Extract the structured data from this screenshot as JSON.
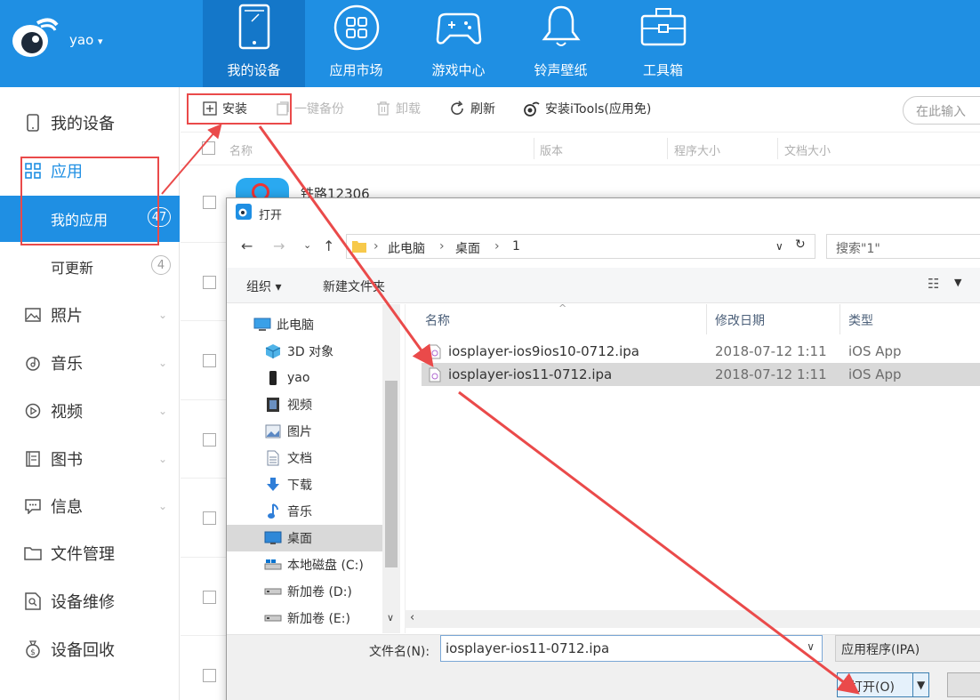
{
  "header": {
    "username": "yao",
    "nav": [
      {
        "label": "我的设备",
        "icon": "phone-icon",
        "active": true
      },
      {
        "label": "应用市场",
        "icon": "apps-grid-icon",
        "active": false
      },
      {
        "label": "游戏中心",
        "icon": "gamepad-icon",
        "active": false
      },
      {
        "label": "铃声壁纸",
        "icon": "bell-icon",
        "active": false
      },
      {
        "label": "工具箱",
        "icon": "toolbox-icon",
        "active": false
      }
    ]
  },
  "sidebar": {
    "my_device": "我的设备",
    "apps": "应用",
    "my_apps": "我的应用",
    "my_apps_count": "47",
    "updatable": "可更新",
    "updatable_count": "4",
    "photos": "照片",
    "music": "音乐",
    "video": "视频",
    "books": "图书",
    "messages": "信息",
    "file_mgmt": "文件管理",
    "repair": "设备维修",
    "recycle": "设备回收"
  },
  "toolbar": {
    "install": "安装",
    "backup": "一键备份",
    "uninstall": "卸载",
    "refresh": "刷新",
    "install_itools": "安装iTools(应用免)",
    "search_placeholder": "在此输入"
  },
  "table": {
    "col_name": "名称",
    "col_version": "版本",
    "col_size": "程序大小",
    "col_doc": "文档大小",
    "row1_name": "铁路12306"
  },
  "dialog": {
    "title": "打开",
    "breadcrumb": [
      "此电脑",
      "桌面",
      "1"
    ],
    "search_placeholder": "搜索\"1\"",
    "organize": "组织 ▾",
    "new_folder": "新建文件夹",
    "tree": [
      {
        "label": "此电脑",
        "icon": "computer-icon"
      },
      {
        "label": "3D 对象",
        "icon": "3d-objects-icon"
      },
      {
        "label": "yao",
        "icon": "iphone-icon"
      },
      {
        "label": "视频",
        "icon": "video-folder-icon"
      },
      {
        "label": "图片",
        "icon": "pictures-folder-icon"
      },
      {
        "label": "文档",
        "icon": "documents-folder-icon"
      },
      {
        "label": "下载",
        "icon": "download-folder-icon"
      },
      {
        "label": "音乐",
        "icon": "music-folder-icon"
      },
      {
        "label": "桌面",
        "icon": "desktop-folder-icon",
        "selected": true
      },
      {
        "label": "本地磁盘 (C:)",
        "icon": "disk-c-icon"
      },
      {
        "label": "新加卷 (D:)",
        "icon": "disk-icon"
      },
      {
        "label": "新加卷 (E:)",
        "icon": "disk-icon"
      }
    ],
    "columns": {
      "name": "名称",
      "modified": "修改日期",
      "type": "类型"
    },
    "files": [
      {
        "name": "iosplayer-ios9ios10-0712.ipa",
        "modified": "2018-07-12 1:11",
        "type": "iOS App",
        "selected": false
      },
      {
        "name": "iosplayer-ios11-0712.ipa",
        "modified": "2018-07-12 1:11",
        "type": "iOS App",
        "selected": true
      }
    ],
    "filename_label": "文件名(N):",
    "filename_value": "iosplayer-ios11-0712.ipa",
    "filetype": "应用程序(IPA)",
    "open_button": "打开(O)"
  },
  "colors": {
    "brand": "#1f8fe3",
    "annotation": "#ea4a4a"
  }
}
